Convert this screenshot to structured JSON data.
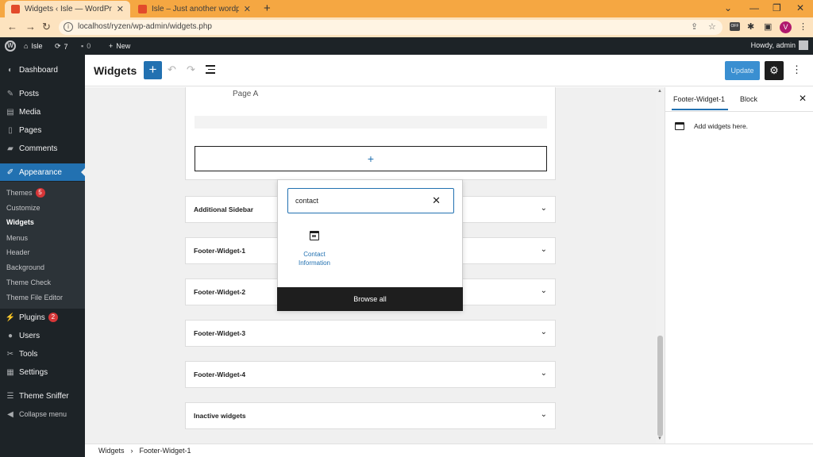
{
  "browser": {
    "tabs": [
      {
        "title": "Widgets ‹ Isle — WordPress",
        "active": true
      },
      {
        "title": "Isle – Just another wordpress theme",
        "active": false
      }
    ],
    "new_tab_glyph": "+",
    "url": "localhost/ryzen/wp-admin/widgets.php",
    "profile_initial": "V",
    "ext_label": "OFF",
    "window_controls": [
      "⌄",
      "—",
      "❐",
      "✕"
    ]
  },
  "adminbar": {
    "site_name": "Isle",
    "updates_count": "7",
    "comments_count": "0",
    "new_label": "New",
    "howdy": "Howdy, admin"
  },
  "menu": {
    "items": [
      {
        "label": "Dashboard",
        "icon": "dashboard-icon"
      },
      {
        "label": "Posts",
        "icon": "pin-icon"
      },
      {
        "label": "Media",
        "icon": "media-icon"
      },
      {
        "label": "Pages",
        "icon": "pages-icon"
      },
      {
        "label": "Comments",
        "icon": "comment-icon"
      },
      {
        "label": "Appearance",
        "icon": "brush-icon"
      },
      {
        "label": "Plugins",
        "icon": "plug-icon",
        "badge": "2"
      },
      {
        "label": "Users",
        "icon": "user-icon"
      },
      {
        "label": "Tools",
        "icon": "wrench-icon"
      },
      {
        "label": "Settings",
        "icon": "settings-icon"
      },
      {
        "label": "Theme Sniffer",
        "icon": "list-icon"
      },
      {
        "label": "Collapse menu",
        "icon": "collapse-icon"
      }
    ],
    "submenu": [
      {
        "label": "Themes",
        "badge": "5"
      },
      {
        "label": "Customize"
      },
      {
        "label": "Widgets"
      },
      {
        "label": "Menus"
      },
      {
        "label": "Header"
      },
      {
        "label": "Background"
      },
      {
        "label": "Theme Check"
      },
      {
        "label": "Theme File Editor"
      }
    ]
  },
  "header": {
    "title": "Widgets",
    "add_glyph": "+",
    "undo_glyph": "↶",
    "redo_glyph": "↷",
    "update_label": "Update",
    "settings_glyph": "⚙",
    "more_glyph": "⋮"
  },
  "canvas": {
    "page_item": "Page A",
    "appender_glyph": "+",
    "areas": [
      "Additional Sidebar",
      "Footer-Widget-1",
      "Footer-Widget-2",
      "Footer-Widget-3",
      "Footer-Widget-4",
      "Inactive widgets"
    ],
    "chevron_glyph": "⌄"
  },
  "inserter": {
    "search_value": "contact",
    "clear_glyph": "✕",
    "result_label": "Contact Information",
    "browse_all": "Browse all"
  },
  "sidebar": {
    "tab_area": "Footer-Widget-1",
    "tab_block": "Block",
    "close_glyph": "✕",
    "message": "Add widgets here."
  },
  "footer": {
    "crumbs": [
      "Widgets",
      "Footer-Widget-1"
    ],
    "sep": "›"
  },
  "colors": {
    "accent": "#2271b1",
    "adminbar": "#1d2327",
    "tabstrip": "#f5a742",
    "toolbar": "#fde3bf",
    "badge": "#d63638"
  }
}
